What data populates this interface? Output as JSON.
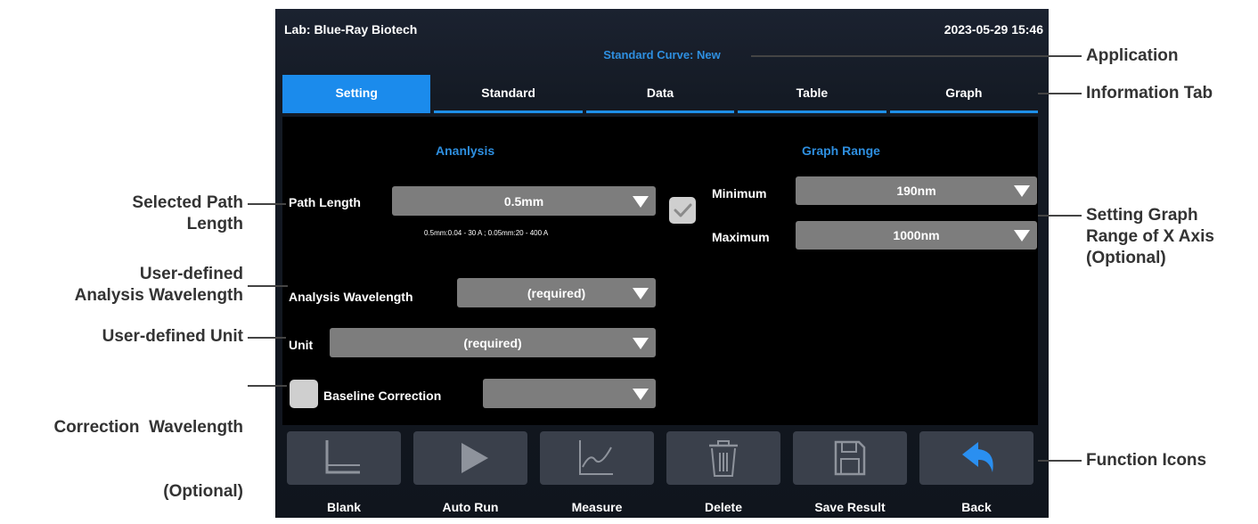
{
  "header": {
    "lab": "Lab: Blue-Ray Biotech",
    "datetime": "2023-05-29 15:46",
    "application": "Standard Curve: New"
  },
  "tabs": [
    {
      "label": "Setting",
      "active": true
    },
    {
      "label": "Standard",
      "active": false
    },
    {
      "label": "Data",
      "active": false
    },
    {
      "label": "Table",
      "active": false
    },
    {
      "label": "Graph",
      "active": false
    }
  ],
  "analysis": {
    "title": "Ananlysis",
    "path_length": {
      "label": "Path Length",
      "value": "0.5mm",
      "note": "0.5mm:0.04 - 30 A ; 0.05mm:20 - 400 A"
    },
    "wavelength": {
      "label": "Analysis Wavelength",
      "value": "(required)"
    },
    "unit": {
      "label": "Unit",
      "value": "(required)"
    },
    "baseline": {
      "label": "Baseline Correction",
      "value": "",
      "checked": false
    }
  },
  "graph_range": {
    "title": "Graph Range",
    "enabled": true,
    "minimum": {
      "label": "Minimum",
      "value": "190nm"
    },
    "maximum": {
      "label": "Maximum",
      "value": "1000nm"
    }
  },
  "functions": [
    {
      "label": "Blank",
      "icon": "blank-icon"
    },
    {
      "label": "Auto Run",
      "icon": "play-icon"
    },
    {
      "label": "Measure",
      "icon": "measure-chart-icon"
    },
    {
      "label": "Delete",
      "icon": "trash-icon"
    },
    {
      "label": "Save Result",
      "icon": "save-icon"
    },
    {
      "label": "Back",
      "icon": "back-arrow-icon"
    }
  ],
  "callouts": {
    "application": "Application",
    "information_tab": "Information Tab",
    "selected_path_length": [
      "Selected Path",
      "Length"
    ],
    "user_defined_wavelength": [
      "User-defined",
      "Analysis Wavelength"
    ],
    "user_defined_unit": "User-defined Unit",
    "correction_wavelength": [
      "Correction  Wavelength",
      "(Optional)"
    ],
    "graph_range_x": [
      "Setting Graph",
      "Range of X Axis",
      "(Optional)"
    ],
    "function_icons": "Function Icons"
  },
  "colors": {
    "accent": "#1b8bec",
    "panel": "#000000",
    "dropdown": "#7d7d7d",
    "toolbar_button": "#3a404b",
    "back_icon": "#2a8ff0"
  }
}
